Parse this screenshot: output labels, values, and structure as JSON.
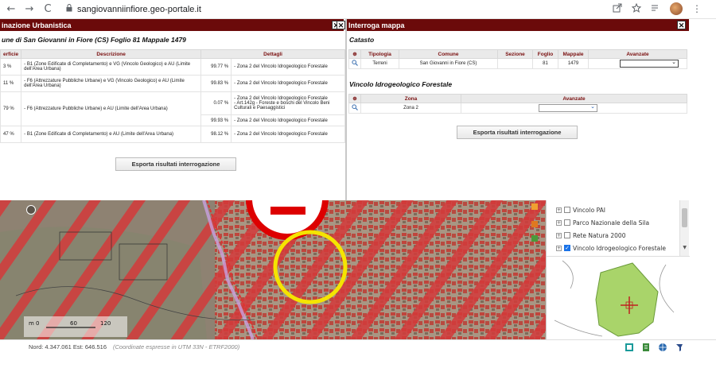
{
  "browser": {
    "back": "←",
    "forward": "→",
    "reload": "C",
    "lock": "🔒",
    "url": "sangiovanniinfiore.geo-portale.it"
  },
  "left_panel": {
    "window_title": "inazione Urbanistica",
    "subtitle": "une di San Giovanni in Fiore (CS) Foglio 81 Mappale 1479",
    "columns": [
      "erficie",
      "Descrizione",
      "Dettagli"
    ],
    "rows": [
      {
        "sup": "3 %",
        "descr": "- B1 (Zone Edificate di Completamento) e VG (Vincolo Geologico) e AU (Limite dell'Area Urbana)",
        "details": [
          {
            "pct": "99.77 %",
            "text": "- Zona 2 del Vincolo Idrogeologico Forestale"
          }
        ]
      },
      {
        "sup": "11 %",
        "descr": "- F6 (Attrezzature Pubbliche Urbane) e VG (Vincolo Geologico) e AU (Limite dell'Area Urbana)",
        "details": [
          {
            "pct": "99.83 %",
            "text": "- Zona 2 del Vincolo Idrogeologico Forestale"
          }
        ]
      },
      {
        "sup": "79 %",
        "descr": "- F6 (Attrezzature Pubbliche Urbane) e AU (Limite dell'Area Urbana)",
        "details": [
          {
            "pct": "0.07 %",
            "text": "- Zona 2 del Vincolo Idrogeologico Forestale\n- Art.142g - Foreste e boschi del Vincolo Beni Culturali e Paesaggistici"
          },
          {
            "pct": "99.93 %",
            "text": "- Zona 2 del Vincolo Idrogeologico Forestale"
          }
        ]
      },
      {
        "sup": "47 %",
        "descr": "- B1 (Zone Edificate di Completamento) e AU (Limite dell'Area Urbana)",
        "details": [
          {
            "pct": "98.12 %",
            "text": "- Zona 2 del Vincolo Idrogeologico Forestale"
          }
        ]
      }
    ],
    "export_button": "Esporta risultati interrogazione"
  },
  "right_panel": {
    "window_title": "Interroga mappa",
    "catasto_title": "Catasto",
    "catasto_columns": [
      "⊕",
      "Tipologia",
      "Comune",
      "Sezione",
      "Foglio",
      "Mappale",
      "Avanzate"
    ],
    "catasto_row": {
      "tipologia": "Terreni",
      "comune": "San Giovanni in Fiore (CS)",
      "sezione": "",
      "foglio": "81",
      "mappale": "1479",
      "avanzate": ""
    },
    "vincolo_title": "Vincolo Idrogeologico Forestale",
    "vincolo_columns": [
      "⊕",
      "Zona",
      "Avanzate"
    ],
    "vincolo_row": {
      "zona": "Zona 2",
      "avanzate": ""
    },
    "export_button": "Esporta risultati interrogazione"
  },
  "map": {
    "scale_labels": [
      "m 0",
      "60",
      "120"
    ]
  },
  "layers": [
    {
      "label": "Vincolo PAI",
      "checked": false
    },
    {
      "label": "Parco Nazionale della Sila",
      "checked": false
    },
    {
      "label": "Rete Natura 2000",
      "checked": false
    },
    {
      "label": "Vincolo Idrogeologico Forestale",
      "checked": true
    }
  ],
  "status": {
    "coords": "Nord: 4.347.061   Est: 646.516",
    "note": "(Coordinate espresse in UTM 33N - ETRF2000)"
  },
  "colors": {
    "header": "#6b0a0a",
    "stripe": "#d43a3a",
    "highlight_circle": "#f5e400",
    "overview_fill": "#a9d46a"
  }
}
